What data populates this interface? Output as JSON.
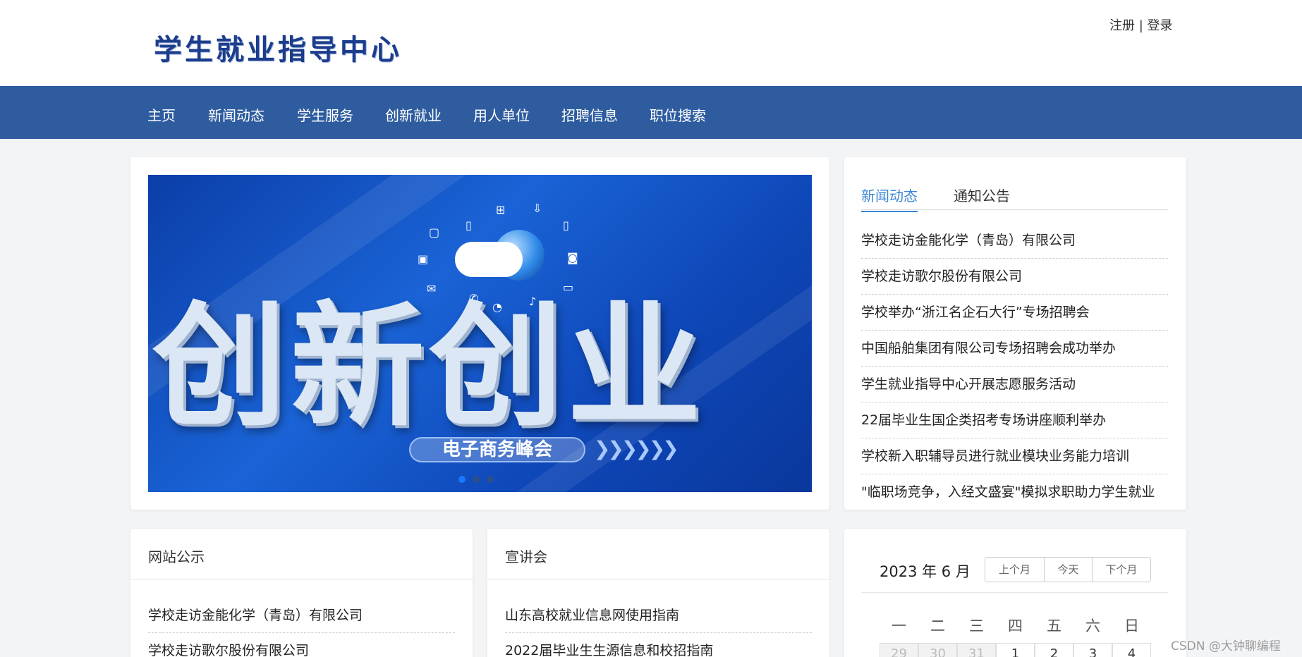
{
  "header": {
    "logo": "学生就业指导中心",
    "register": "注册",
    "separator": " | ",
    "login": "登录"
  },
  "nav": {
    "items": [
      "主页",
      "新闻动态",
      "学生服务",
      "创新就业",
      "用人单位",
      "招聘信息",
      "职位搜索"
    ]
  },
  "banner": {
    "headline": "创新创业",
    "subtitle": "电子商务峰会",
    "slides_total": 3,
    "slides_active_index": 0
  },
  "news_panel": {
    "tabs": [
      "新闻动态",
      "通知公告"
    ],
    "active_tab": "新闻动态",
    "items": [
      "学校走访金能化学（青岛）有限公司",
      "学校走访歌尔股份有限公司",
      "学校举办“浙江名企石大行”专场招聘会",
      "中国船舶集团有限公司专场招聘会成功举办",
      "学生就业指导中心开展志愿服务活动",
      "22届毕业生国企类招考专场讲座顺利举办",
      "学校新入职辅导员进行就业模块业务能力培训",
      "\"临职场竞争，入经文盛宴\"模拟求职助力学生就业"
    ]
  },
  "notice_panel": {
    "title": "网站公示",
    "items": [
      "学校走访金能化学（青岛）有限公司",
      "学校走访歌尔股份有限公司"
    ]
  },
  "talk_panel": {
    "title": "宣讲会",
    "items": [
      "山东高校就业信息网使用指南",
      "2022届毕业生生源信息和校招指南"
    ]
  },
  "calendar": {
    "title": "2023 年 6 月",
    "prev_label": "上个月",
    "today_label": "今天",
    "next_label": "下个月",
    "weekdays": [
      "一",
      "二",
      "三",
      "四",
      "五",
      "六",
      "日"
    ],
    "first_row": [
      "29",
      "30",
      "31",
      "1",
      "2",
      "3",
      "4"
    ]
  },
  "watermark": "CSDN @大钟聊编程",
  "colors": {
    "nav_bg": "#2e5c9f",
    "logo": "#1c3d8c",
    "active_tab": "#3a86d6"
  }
}
